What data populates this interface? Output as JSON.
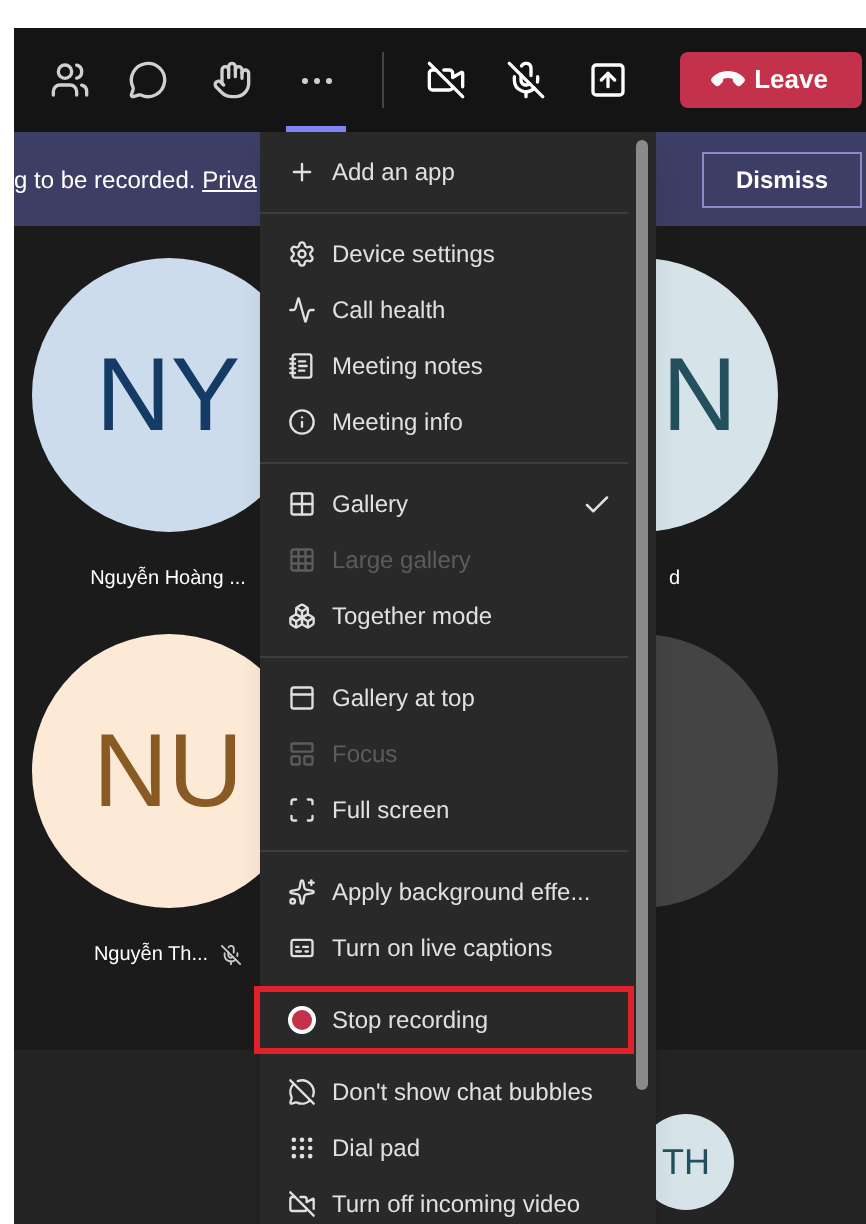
{
  "toolbar": {
    "more_selected": true,
    "leave_button": "Leave"
  },
  "banner": {
    "text": "g to be recorded.",
    "link": "Priva",
    "dismiss": "Dismiss"
  },
  "participants": [
    {
      "initials": "NY",
      "name": "Nguyễn Hoàng ...",
      "muted": false,
      "color": "#cddcec"
    },
    {
      "initials": "NU",
      "name": "Nguyễn Th...",
      "muted": true,
      "color": "#fce9d6"
    },
    {
      "initials": "N",
      "name": "d",
      "muted": false,
      "color": "#d6e4ea"
    },
    {
      "color": "#444444"
    }
  ],
  "small_avatar": {
    "initials": "TH"
  },
  "menu": {
    "groups": [
      [
        {
          "label": "Add an app",
          "disabled": false,
          "checked": false,
          "annotated": false
        }
      ],
      [
        {
          "label": "Device settings",
          "disabled": false,
          "checked": false,
          "annotated": false
        },
        {
          "label": "Call health",
          "disabled": false,
          "checked": false,
          "annotated": false
        },
        {
          "label": "Meeting notes",
          "disabled": false,
          "checked": false,
          "annotated": false
        },
        {
          "label": "Meeting info",
          "disabled": false,
          "checked": false,
          "annotated": false
        }
      ],
      [
        {
          "label": "Gallery",
          "disabled": false,
          "checked": true,
          "annotated": false
        },
        {
          "label": "Large gallery",
          "disabled": true,
          "checked": false,
          "annotated": false
        },
        {
          "label": "Together mode",
          "disabled": false,
          "checked": false,
          "annotated": false
        }
      ],
      [
        {
          "label": "Gallery at top",
          "disabled": false,
          "checked": false,
          "annotated": false
        },
        {
          "label": "Focus",
          "disabled": true,
          "checked": false,
          "annotated": false
        },
        {
          "label": "Full screen",
          "disabled": false,
          "checked": false,
          "annotated": false
        }
      ],
      [
        {
          "label": "Apply background effe...",
          "disabled": false,
          "checked": false,
          "annotated": false
        },
        {
          "label": "Turn on live captions",
          "disabled": false,
          "checked": false,
          "annotated": false
        },
        {
          "label": "Stop recording",
          "disabled": false,
          "checked": false,
          "annotated": true
        },
        {
          "label": "Don't show chat bubbles",
          "disabled": false,
          "checked": false,
          "annotated": false
        },
        {
          "label": "Dial pad",
          "disabled": false,
          "checked": false,
          "annotated": false
        },
        {
          "label": "Turn off incoming video",
          "disabled": false,
          "checked": false,
          "annotated": false
        }
      ]
    ]
  }
}
